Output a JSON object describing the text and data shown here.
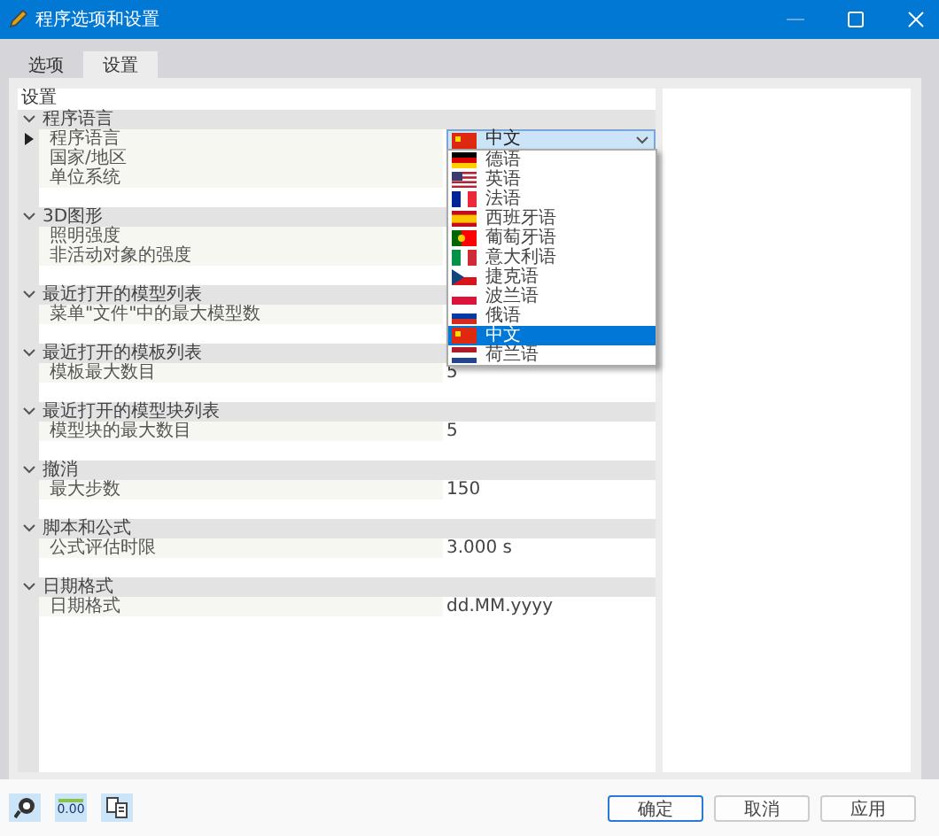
{
  "window": {
    "title": "程序选项和设置"
  },
  "tabs": [
    {
      "label": "选项",
      "selected": false
    },
    {
      "label": "设置",
      "selected": true
    }
  ],
  "grid": {
    "title": "设置",
    "groups": [
      {
        "title": "程序语言",
        "expanded": true,
        "rows": [
          {
            "label": "程序语言",
            "current": true,
            "kind": "dropdown",
            "value": "中文"
          },
          {
            "label": "国家/地区",
            "current": false
          },
          {
            "label": "单位系统",
            "current": false
          }
        ]
      },
      {
        "title": "3D图形",
        "expanded": true,
        "rows": [
          {
            "label": "照明强度",
            "current": false
          },
          {
            "label": "非活动对象的强度",
            "current": false
          }
        ]
      },
      {
        "title": "最近打开的模型列表",
        "expanded": true,
        "rows": [
          {
            "label": "菜单\"文件\"中的最大模型数",
            "current": false
          }
        ]
      },
      {
        "title": "最近打开的模板列表",
        "expanded": true,
        "rows": [
          {
            "label": "模板最大数目",
            "current": false,
            "value": "5"
          }
        ]
      },
      {
        "title": "最近打开的模型块列表",
        "expanded": true,
        "rows": [
          {
            "label": "模型块的最大数目",
            "current": false,
            "value": "5"
          }
        ]
      },
      {
        "title": "撤消",
        "expanded": true,
        "rows": [
          {
            "label": "最大步数",
            "current": false,
            "value": "150"
          }
        ]
      },
      {
        "title": "脚本和公式",
        "expanded": true,
        "rows": [
          {
            "label": "公式评估时限",
            "current": false,
            "value": "3.000 s"
          }
        ]
      },
      {
        "title": "日期格式",
        "expanded": true,
        "rows": [
          {
            "label": "日期格式",
            "current": false,
            "value": "dd.MM.yyyy"
          }
        ]
      }
    ]
  },
  "language_dropdown": {
    "items": [
      {
        "label": "德语",
        "selected": false
      },
      {
        "label": "英语",
        "selected": false
      },
      {
        "label": "法语",
        "selected": false
      },
      {
        "label": "西班牙语",
        "selected": false
      },
      {
        "label": "葡萄牙语",
        "selected": false
      },
      {
        "label": "意大利语",
        "selected": false
      },
      {
        "label": "捷克语",
        "selected": false
      },
      {
        "label": "波兰语",
        "selected": false
      },
      {
        "label": "俄语",
        "selected": false
      },
      {
        "label": "中文",
        "selected": true
      },
      {
        "label": "荷兰语",
        "selected": false
      }
    ]
  },
  "tools": [
    {
      "kind": "help"
    },
    {
      "kind": "decimals",
      "label": "0.00"
    },
    {
      "kind": "units"
    }
  ],
  "buttons": [
    {
      "label": "确定",
      "default": true
    },
    {
      "label": "取消",
      "default": false
    },
    {
      "label": "应用",
      "default": false
    }
  ]
}
